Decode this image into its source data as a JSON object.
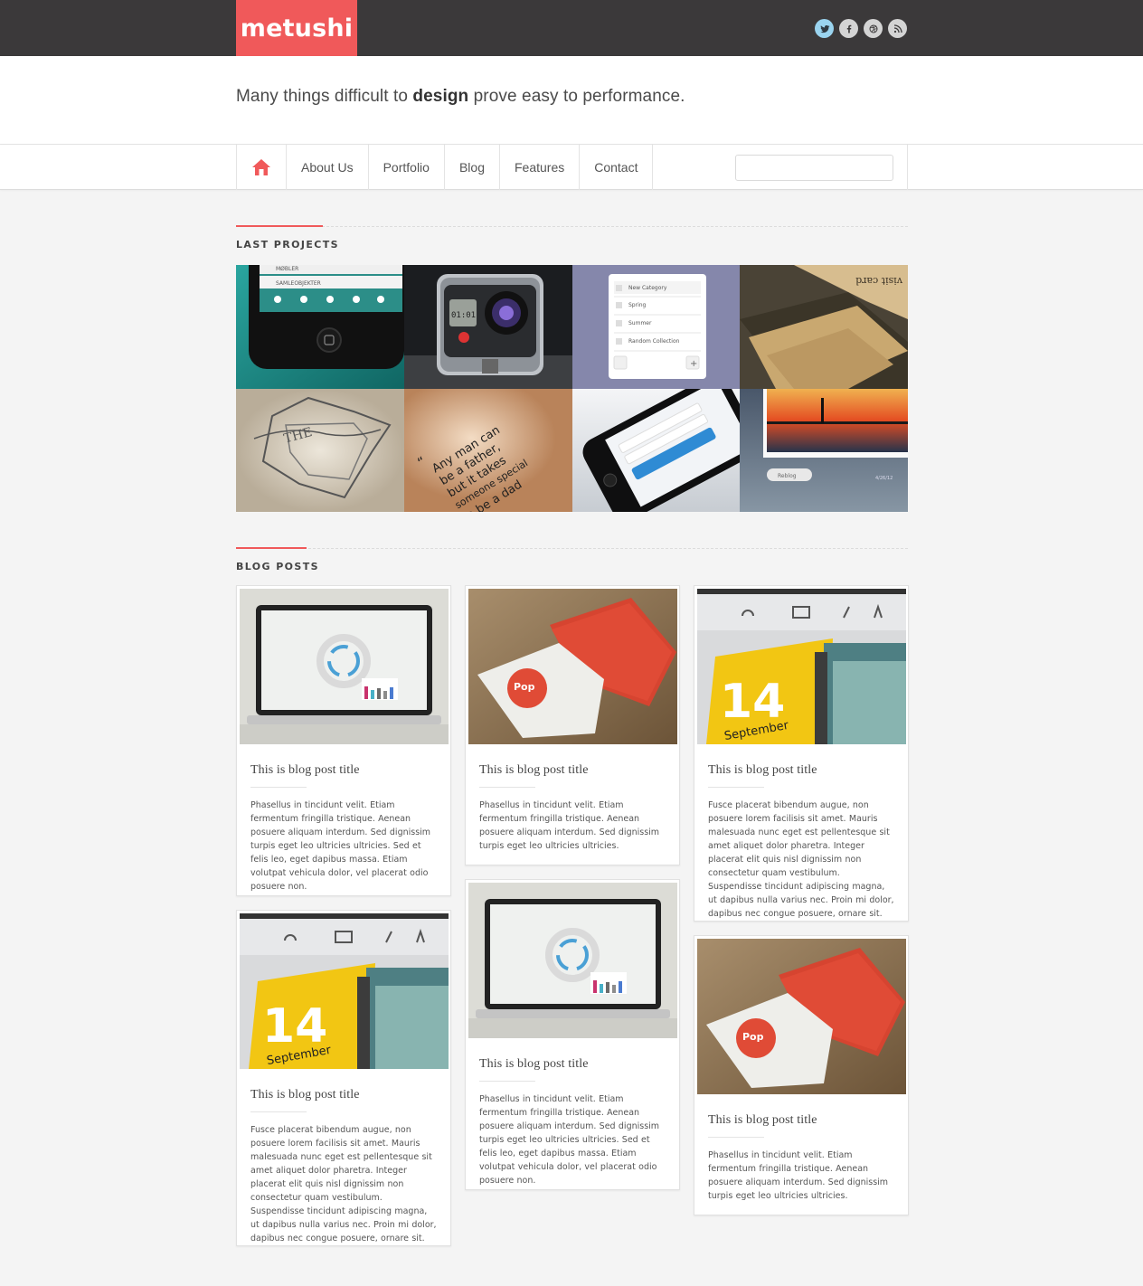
{
  "brand": {
    "logo": "metushi",
    "accent": "#f0595a",
    "topbar_bg": "#3b393a"
  },
  "social": [
    {
      "icon": "twitter-icon",
      "glyph": "t"
    },
    {
      "icon": "facebook-icon",
      "glyph": "f"
    },
    {
      "icon": "dribbble-icon",
      "glyph": "◎"
    },
    {
      "icon": "rss-icon",
      "glyph": ")"
    }
  ],
  "tagline": {
    "before": "Many things difficult to ",
    "bold": "design",
    "after": " prove easy to performance."
  },
  "nav": {
    "home_icon": "home-icon",
    "items": [
      "About Us",
      "Portfolio",
      "Blog",
      "Features",
      "Contact"
    ],
    "search_placeholder": ""
  },
  "sections": {
    "projects": "LAST PROJECTS",
    "blog": "BLOG POSTS"
  },
  "projects": [
    {
      "name": "phone-app-menu"
    },
    {
      "name": "action-camera"
    },
    {
      "name": "category-list-ui"
    },
    {
      "name": "business-cards"
    },
    {
      "name": "shield-sketch"
    },
    {
      "name": "quote-print"
    },
    {
      "name": "iphone-login"
    },
    {
      "name": "sunset-photo-widget"
    }
  ],
  "posts": [
    {
      "title": "This is blog post title",
      "text": "Phasellus in tincidunt velit. Etiam fermentum fringilla tristique. Aenean posuere aliquam interdum. Sed dignissim turpis eget leo ultricies ultricies. Sed et felis leo, eget dapibus massa. Etiam volutpat vehicula dolor, vel placerat odio posuere non."
    },
    {
      "title": "This is blog post title",
      "text": "Phasellus in tincidunt velit. Etiam fermentum fringilla tristique. Aenean posuere aliquam interdum. Sed dignissim turpis eget leo ultricies ultricies."
    },
    {
      "title": "This is blog post title",
      "text": "Fusce placerat bibendum augue, non posuere lorem facilisis sit amet. Mauris malesuada nunc eget est pellentesque sit amet aliquet dolor pharetra. Integer placerat elit quis nisl dignissim non consectetur quam vestibulum. Suspendisse tincidunt adipiscing magna, ut dapibus nulla varius nec. Proin mi dolor, dapibus nec congue posuere, ornare sit."
    },
    {
      "title": "This is blog post title",
      "text": "Fusce placerat bibendum augue, non posuere lorem facilisis sit amet. Mauris malesuada nunc eget est pellentesque sit amet aliquet dolor pharetra. Integer placerat elit quis nisl dignissim non consectetur quam vestibulum. Suspendisse tincidunt adipiscing magna, ut dapibus nulla varius nec. Proin mi dolor, dapibus nec congue posuere, ornare sit."
    },
    {
      "title": "This is blog post title",
      "text": "Phasellus in tincidunt velit. Etiam fermentum fringilla tristique. Aenean posuere aliquam interdum. Sed dignissim turpis eget leo ultricies ultricies. Sed et felis leo, eget dapibus massa. Etiam volutpat vehicula dolor, vel placerat odio posuere non."
    },
    {
      "title": "This is blog post title",
      "text": "Phasellus in tincidunt velit. Etiam fermentum fringilla tristique. Aenean posuere aliquam interdum. Sed dignissim turpis eget leo ultricies ultricies."
    }
  ]
}
